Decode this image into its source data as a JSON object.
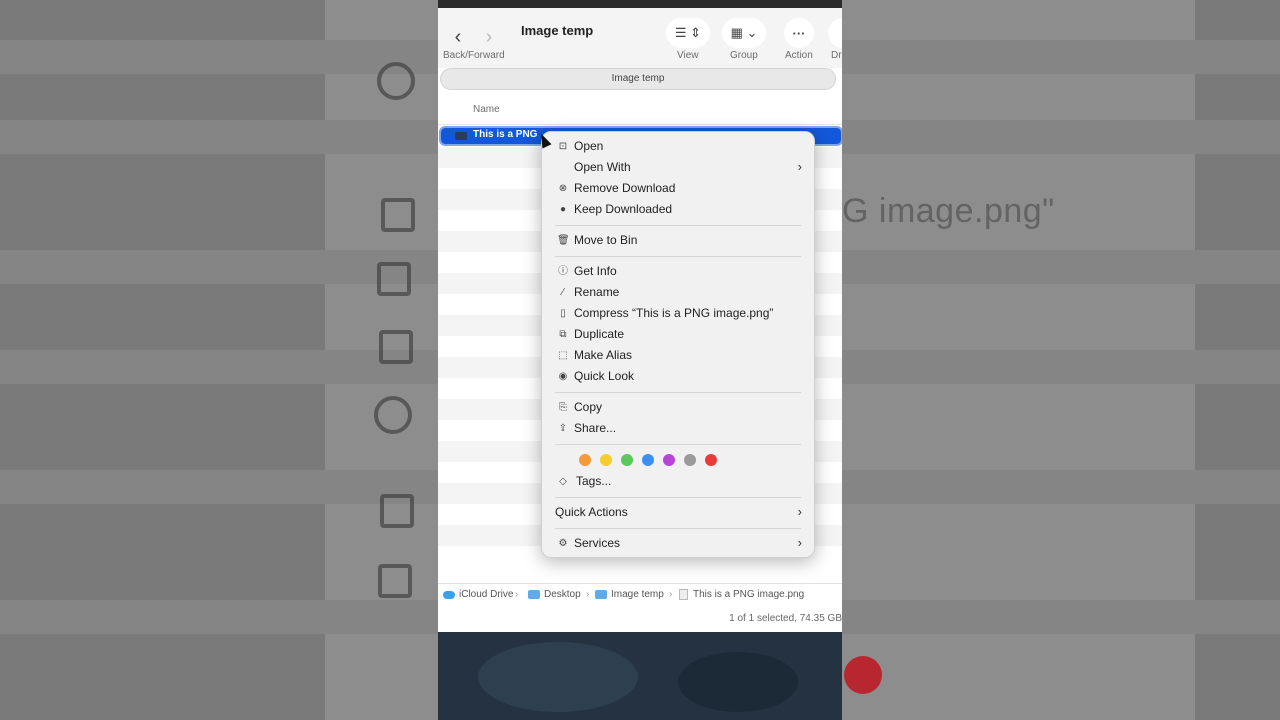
{
  "window": {
    "title": "Image temp",
    "path_tab": "Image temp",
    "column_header": "Name",
    "selected_file": "This is a PNG",
    "toolbar": {
      "back_forward_label": "Back/Forward",
      "view_label": "View",
      "group_label": "Group",
      "action_label": "Action",
      "cut_label": "Dr"
    },
    "path": [
      "iCloud Drive",
      "Desktop",
      "Image temp",
      "This is a PNG image.png"
    ],
    "status": "1 of 1 selected, 74.35 GB"
  },
  "context_menu": {
    "items": [
      {
        "label": "Open",
        "icon": "open-icon"
      },
      {
        "label": "Open With",
        "icon": "none",
        "submenu": true
      },
      {
        "label": "Remove Download",
        "icon": "remove-download-icon"
      },
      {
        "label": "Keep Downloaded",
        "icon": "keep-downloaded-icon"
      },
      {
        "label": "Move to Bin",
        "icon": "trash-icon"
      },
      {
        "label": "Get Info",
        "icon": "info-icon"
      },
      {
        "label": "Rename",
        "icon": "pencil-icon"
      },
      {
        "label": "Compress “This is a PNG image.png”",
        "icon": "zip-icon"
      },
      {
        "label": "Duplicate",
        "icon": "duplicate-icon"
      },
      {
        "label": "Make Alias",
        "icon": "alias-icon"
      },
      {
        "label": "Quick Look",
        "icon": "eye-icon"
      },
      {
        "label": "Copy",
        "icon": "copy-icon"
      },
      {
        "label": "Share...",
        "icon": "share-icon"
      },
      {
        "label": "Tags...",
        "icon": "tag-icon"
      },
      {
        "label": "Quick Actions",
        "icon": "none",
        "submenu": true
      },
      {
        "label": "Services",
        "icon": "services-icon",
        "submenu": true
      }
    ],
    "tag_colors": [
      "#f39a3a",
      "#f5cd30",
      "#5ac85a",
      "#3b8ff0",
      "#b845d9",
      "#9a9a9a",
      "#ea3b3b"
    ]
  },
  "background": {
    "blurred_text": "G image.png\""
  }
}
